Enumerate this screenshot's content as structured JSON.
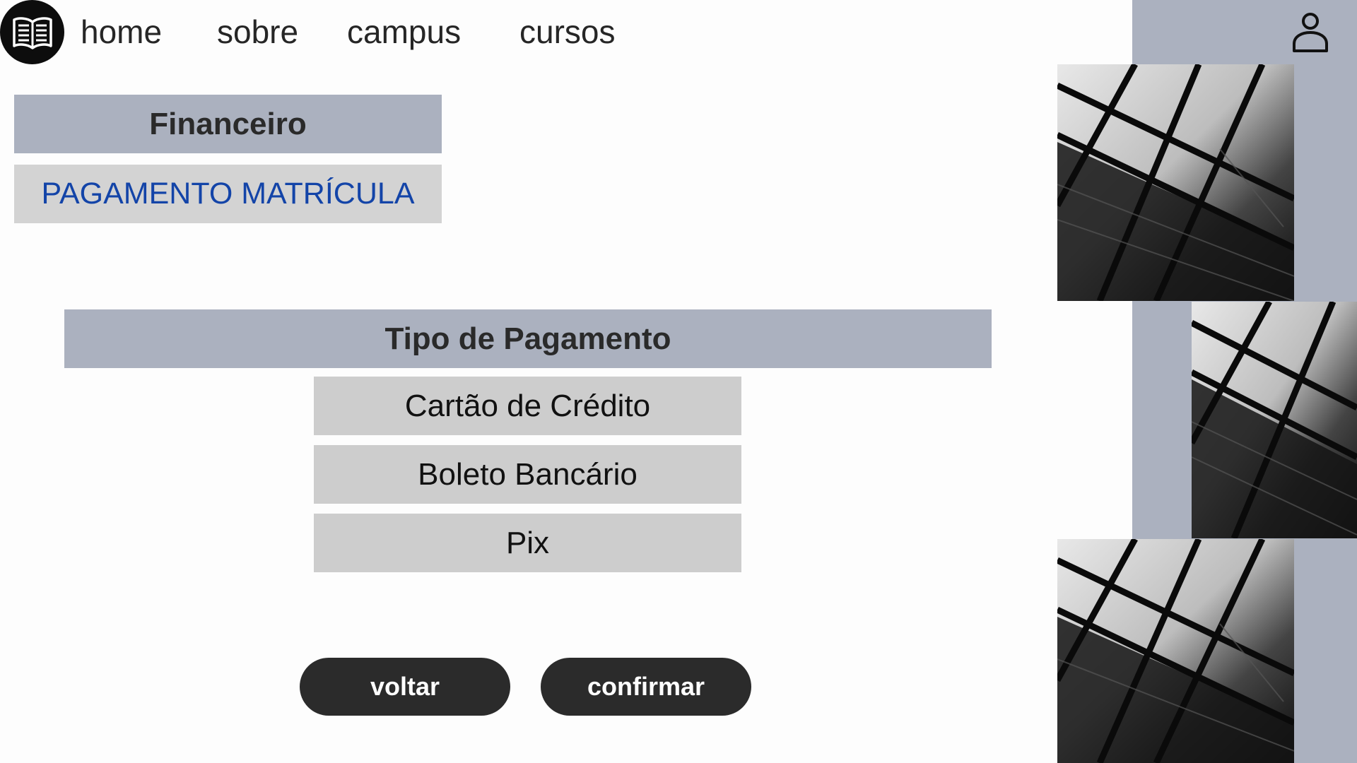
{
  "nav": {
    "logo_icon": "open-book-icon",
    "links": [
      "home",
      "sobre",
      "campus",
      "cursos"
    ],
    "user_icon": "user-icon"
  },
  "sections": {
    "financeiro": "Financeiro",
    "pagamento_matricula": "PAGAMENTO MATRÍCULA"
  },
  "payment": {
    "title": "Tipo de Pagamento",
    "options": [
      "Cartão de Crédito",
      "Boleto Bancário",
      "Pix"
    ]
  },
  "buttons": {
    "back": "voltar",
    "confirm": "confirmar"
  },
  "colors": {
    "panel": "#abb1bf",
    "option_bg": "#cdcdcd",
    "button_bg": "#2b2b2b",
    "accent_text": "#1344a8"
  }
}
